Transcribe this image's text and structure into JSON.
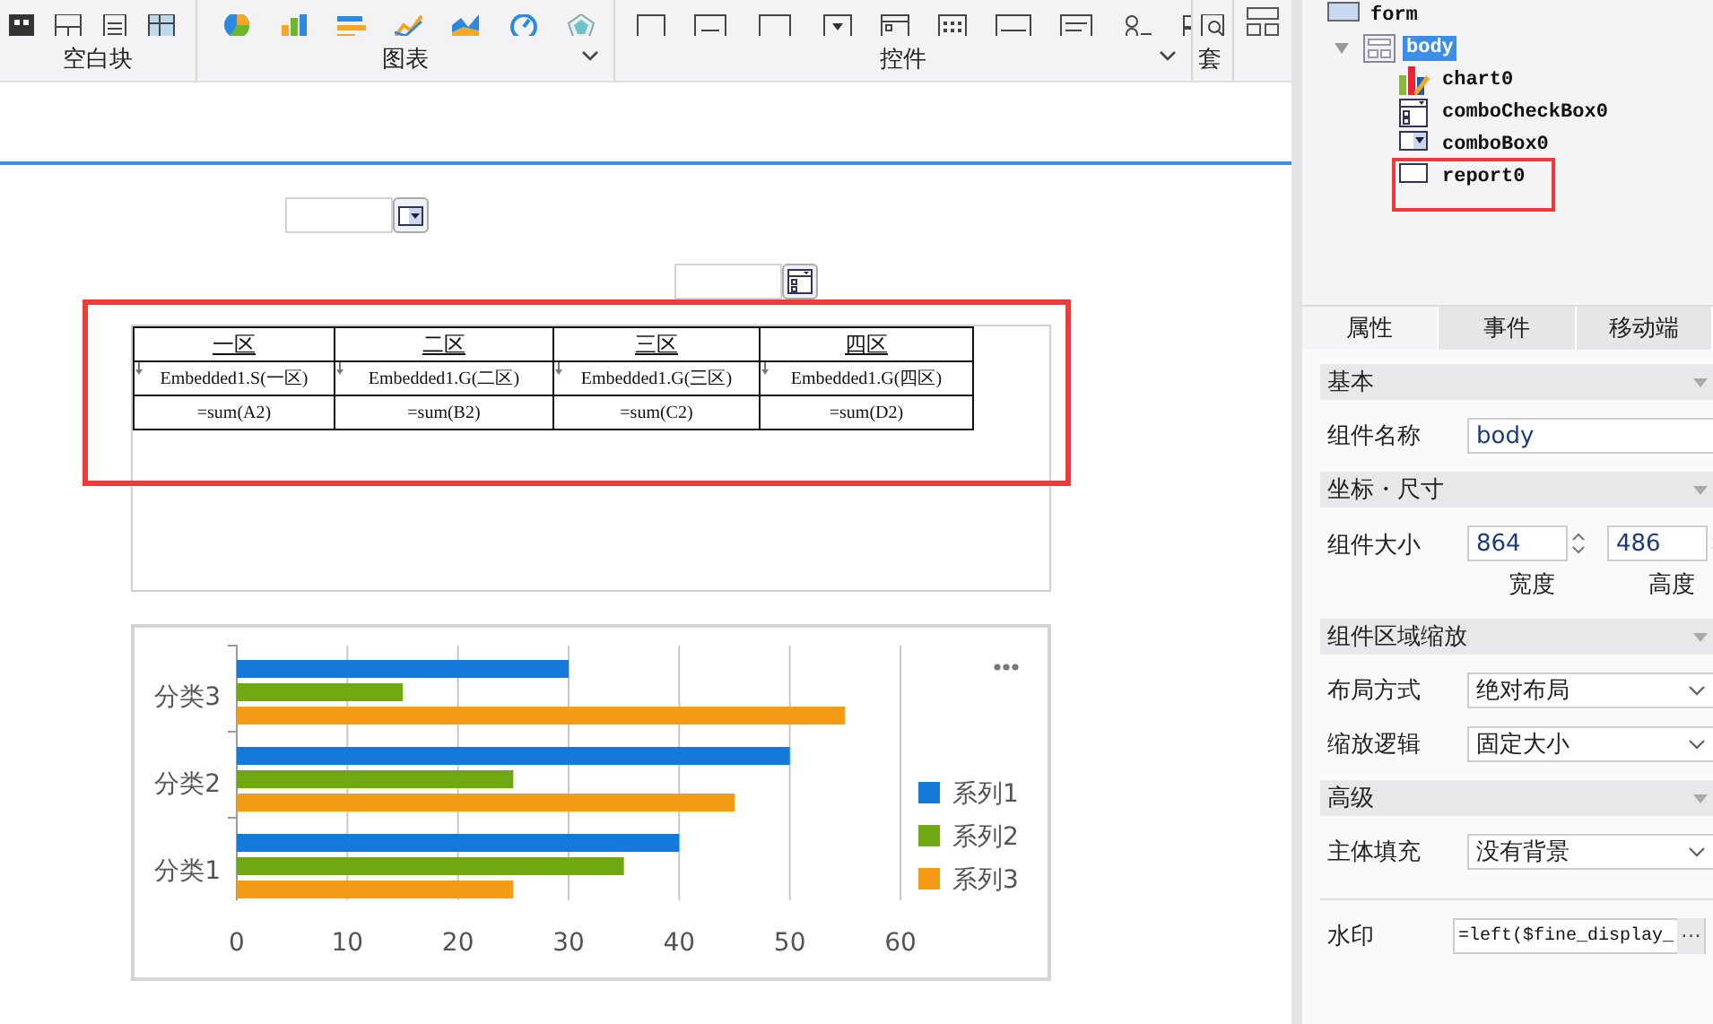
{
  "toolbar": {
    "groups": [
      {
        "label": "空白块",
        "has_menu": false
      },
      {
        "label": "图表",
        "has_menu": true
      },
      {
        "label": "控件",
        "has_menu": true
      },
      {
        "label": "套",
        "has_menu": false
      }
    ]
  },
  "canvas": {
    "widgets": [
      {
        "kind": "combo-box"
      },
      {
        "kind": "combo-check-box"
      },
      {
        "kind": "report",
        "highlighted": true,
        "rows": [
          {
            "kind": "header",
            "cells": [
              "一区",
              "二区",
              "三区",
              "四区"
            ]
          },
          {
            "kind": "expand",
            "cells": [
              "Embedded1.S(一区)",
              "Embedded1.G(二区)",
              "Embedded1.G(三区)",
              "Embedded1.G(四区)"
            ]
          },
          {
            "kind": "formula",
            "cells": [
              "=sum(A2)",
              "=sum(B2)",
              "=sum(C2)",
              "=sum(D2)"
            ]
          }
        ]
      },
      {
        "kind": "chart",
        "chart_data": {
          "type": "bar",
          "orientation": "horizontal",
          "categories": [
            "分类3",
            "分类2",
            "分类1"
          ],
          "series": [
            {
              "name": "系列1",
              "color": "#1479d9",
              "values": [
                30,
                50,
                40
              ]
            },
            {
              "name": "系列2",
              "color": "#6fa812",
              "values": [
                15,
                25,
                35
              ]
            },
            {
              "name": "系列3",
              "color": "#f59c14",
              "values": [
                55,
                45,
                25
              ]
            }
          ],
          "xlim": [
            0,
            60
          ],
          "xticks": [
            0,
            10,
            20,
            30,
            40,
            50,
            60
          ],
          "grid": true,
          "legend": true
        }
      }
    ]
  },
  "tree": {
    "nodes": [
      {
        "kind": "form",
        "label": "form",
        "selected": false,
        "highlighted": false,
        "children": [
          {
            "kind": "body",
            "label": "body",
            "selected": true,
            "highlighted": false,
            "expanded": true,
            "children": [
              {
                "kind": "chart",
                "label": "chart0",
                "selected": false,
                "highlighted": false
              },
              {
                "kind": "combo-check-box",
                "label": "comboCheckBox0",
                "selected": false,
                "highlighted": false
              },
              {
                "kind": "combo-box",
                "label": "comboBox0",
                "selected": false,
                "highlighted": false
              },
              {
                "kind": "report",
                "label": "report0",
                "selected": false,
                "highlighted": true
              }
            ]
          }
        ]
      }
    ]
  },
  "properties": {
    "tabs": [
      {
        "label": "属性",
        "selected": true
      },
      {
        "label": "事件",
        "selected": false
      },
      {
        "label": "移动端",
        "selected": false
      }
    ],
    "rows": [
      {
        "kind": "section",
        "label": "基本",
        "expanded": true
      },
      {
        "kind": "text",
        "label": "组件名称",
        "value": "body"
      },
      {
        "kind": "section",
        "label": "坐标・尺寸",
        "expanded": true
      },
      {
        "kind": "size",
        "label": "组件大小",
        "fields": [
          {
            "value": "864",
            "caption": "宽度"
          },
          {
            "value": "486",
            "caption": "高度"
          }
        ]
      },
      {
        "kind": "section",
        "label": "组件区域缩放",
        "expanded": true
      },
      {
        "kind": "select",
        "label": "布局方式",
        "value": "绝对布局"
      },
      {
        "kind": "select",
        "label": "缩放逻辑",
        "value": "固定大小"
      },
      {
        "kind": "section",
        "label": "高级",
        "expanded": true
      },
      {
        "kind": "select",
        "label": "主体填充",
        "value": "没有背景"
      },
      {
        "kind": "watermark",
        "label": "水印",
        "value": "=left($fine_display_",
        "button": "···"
      }
    ]
  }
}
